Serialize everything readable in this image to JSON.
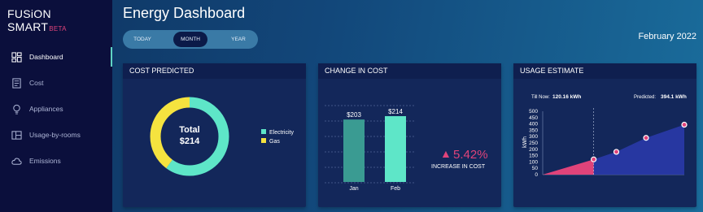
{
  "brand": {
    "name": "FUSiON SMART",
    "badge": "BETA"
  },
  "sidebar": {
    "items": [
      {
        "label": "Dashboard",
        "icon": "dashboard-icon",
        "active": true
      },
      {
        "label": "Cost",
        "icon": "cost-icon",
        "active": false
      },
      {
        "label": "Appliances",
        "icon": "bulb-icon",
        "active": false
      },
      {
        "label": "Usage-by-rooms",
        "icon": "rooms-icon",
        "active": false
      },
      {
        "label": "Emissions",
        "icon": "cloud-icon",
        "active": false
      }
    ]
  },
  "header": {
    "title": "Energy Dashboard",
    "date": "February 2022"
  },
  "period": {
    "options": [
      "TODAY",
      "MONTH",
      "YEAR"
    ],
    "selected": "MONTH"
  },
  "colors": {
    "electricity": "#5ee6c8",
    "gas": "#f5e33f",
    "accent": "#e0437a",
    "barJan": "#3a9b92",
    "barFeb": "#5ee6c8",
    "usageActual": "#e0437a",
    "usagePredicted": "#2a3aa8"
  },
  "cards": {
    "cost_predicted": {
      "title": "COST PREDICTED",
      "total_label": "Total",
      "total_value": "$214",
      "legend": [
        "Electricity",
        "Gas"
      ]
    },
    "change_in_cost": {
      "title": "CHANGE IN COST",
      "change_value": "5.42%",
      "change_label": "INCREASE IN COST"
    },
    "usage_estimate": {
      "title": "USAGE ESTIMATE",
      "till_now_label": "Till Now:",
      "till_now_value": "120.16 kWh",
      "predicted_label": "Predicted:",
      "predicted_value": "394.1 kWh"
    }
  },
  "chart_data": [
    {
      "type": "pie",
      "title": "COST PREDICTED",
      "labels": [
        "Electricity",
        "Gas"
      ],
      "values": [
        0.6,
        0.4
      ]
    },
    {
      "type": "bar",
      "title": "CHANGE IN COST",
      "categories": [
        "Jan",
        "Feb"
      ],
      "values": [
        203,
        214
      ],
      "value_labels": [
        "$203",
        "$214"
      ]
    },
    {
      "type": "area",
      "title": "USAGE ESTIMATE",
      "ylabel": "kWh",
      "yticks": [
        0,
        50,
        100,
        150,
        200,
        250,
        300,
        350,
        400,
        450,
        500
      ],
      "ylim": [
        0,
        500
      ],
      "series": [
        {
          "values_x": [
            0,
            0.36
          ],
          "values_y": [
            0,
            120.16
          ]
        },
        {
          "values_x": [
            0.36,
            0.52,
            0.73,
            1.0
          ],
          "values_y": [
            120.16,
            180,
            290,
            394.1
          ]
        }
      ]
    }
  ]
}
